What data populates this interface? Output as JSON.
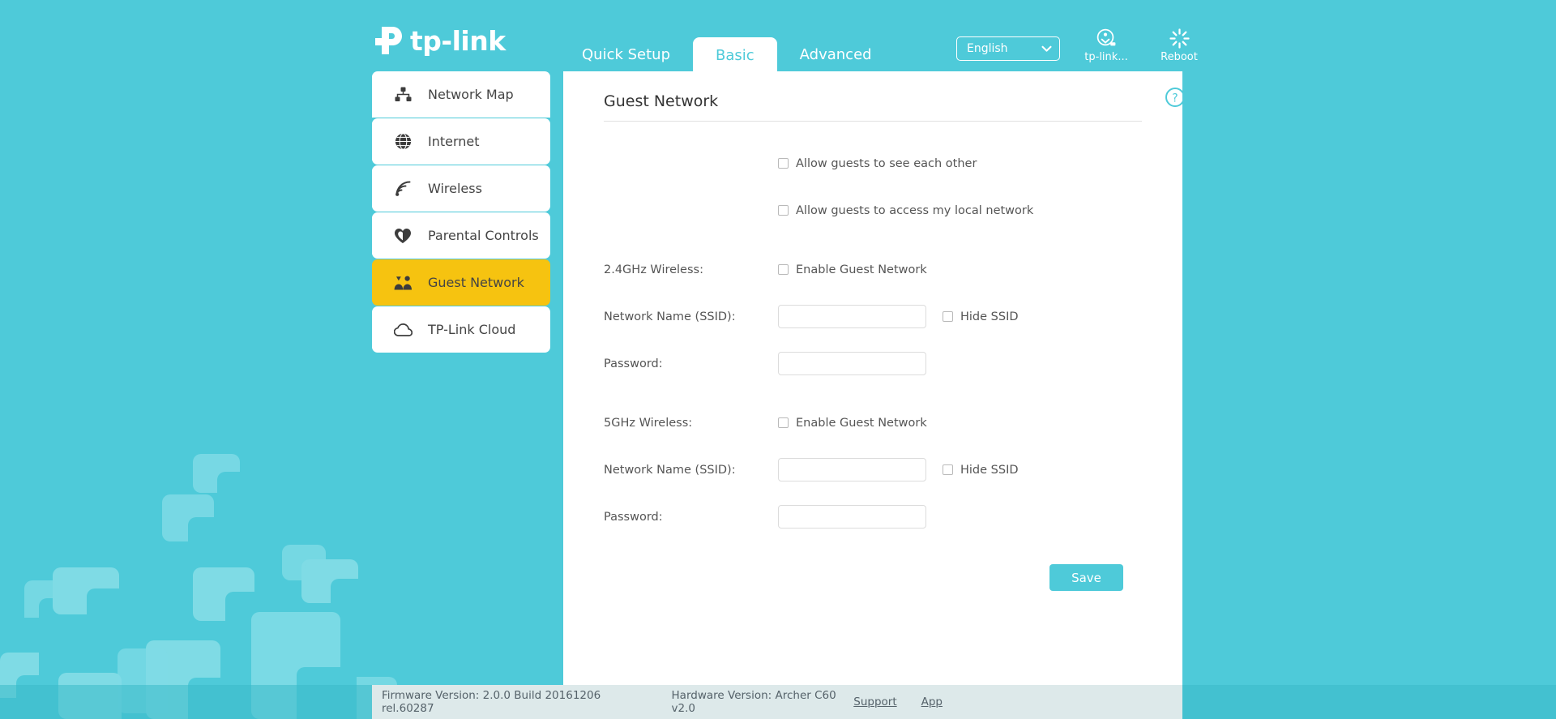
{
  "brand": {
    "name": "tp-link",
    "logo_icon": "tp-link-logo-icon"
  },
  "colors": {
    "background_teal": "#4ecad9",
    "panel_white": "#ffffff",
    "active_sidebar_amber": "#f6c310",
    "footer_grey": "#dde9ea",
    "accent": "#4ecad9"
  },
  "header": {
    "tabs": [
      {
        "label": "Quick Setup",
        "active": false
      },
      {
        "label": "Basic",
        "active": true
      },
      {
        "label": "Advanced",
        "active": false
      }
    ],
    "language": {
      "value": "English",
      "icon": "chevron-down-icon"
    },
    "cloud_button": {
      "label": "tp-link...",
      "icon": "tplink-cloud-account-icon"
    },
    "reboot_button": {
      "label": "Reboot",
      "icon": "reboot-spinner-icon"
    }
  },
  "sidebar": {
    "items": [
      {
        "label": "Network Map",
        "icon": "sitemap-icon",
        "active": false
      },
      {
        "label": "Internet",
        "icon": "globe-icon",
        "active": false
      },
      {
        "label": "Wireless",
        "icon": "wifi-signal-icon",
        "active": false
      },
      {
        "label": "Parental Controls",
        "icon": "heart-icon",
        "active": false
      },
      {
        "label": "Guest Network",
        "icon": "people-group-icon",
        "active": true
      },
      {
        "label": "TP-Link Cloud",
        "icon": "cloud-icon",
        "active": false
      }
    ]
  },
  "main": {
    "title": "Guest Network",
    "help_icon": "question-circle-icon",
    "global_options": [
      {
        "label": "Allow guests to see each other",
        "checked": false
      },
      {
        "label": "Allow guests to access my local network",
        "checked": false
      }
    ],
    "bands": [
      {
        "band_label": "2.4GHz Wireless:",
        "enable": {
          "label": "Enable Guest Network",
          "checked": false
        },
        "ssid": {
          "label": "Network Name (SSID):",
          "value": "",
          "placeholder": ""
        },
        "hide_ssid": {
          "label": "Hide SSID",
          "checked": false
        },
        "password": {
          "label": "Password:",
          "value": "",
          "placeholder": ""
        }
      },
      {
        "band_label": "5GHz Wireless:",
        "enable": {
          "label": "Enable Guest Network",
          "checked": false
        },
        "ssid": {
          "label": "Network Name (SSID):",
          "value": "",
          "placeholder": ""
        },
        "hide_ssid": {
          "label": "Hide SSID",
          "checked": false
        },
        "password": {
          "label": "Password:",
          "value": "",
          "placeholder": ""
        }
      }
    ],
    "save_label": "Save"
  },
  "footer": {
    "firmware_version": "Firmware Version: 2.0.0 Build 20161206 rel.60287",
    "hardware_version": "Hardware Version: Archer C60 v2.0",
    "links": [
      {
        "label": "Support"
      },
      {
        "label": "App"
      }
    ]
  }
}
